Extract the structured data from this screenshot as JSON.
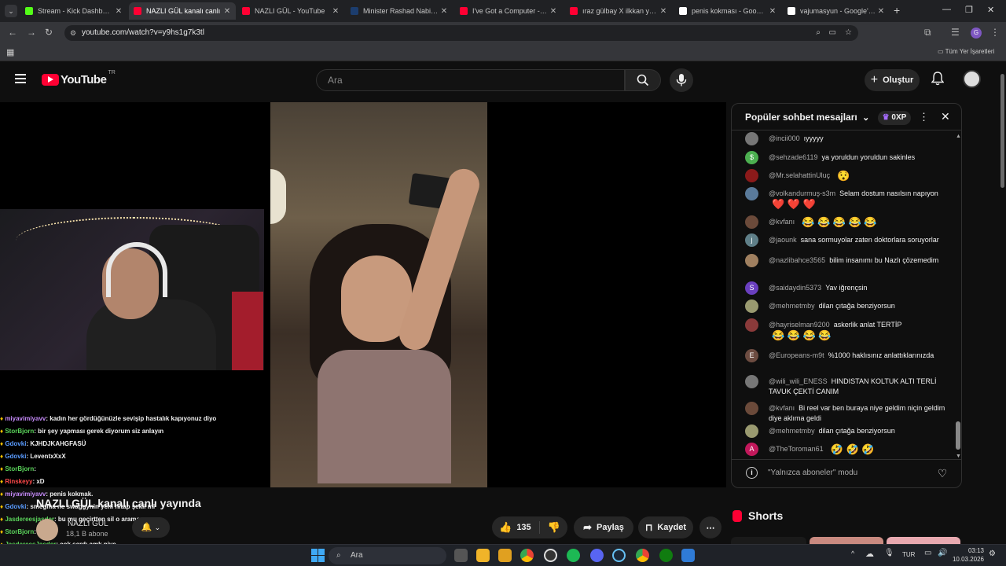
{
  "browser": {
    "tabs": [
      {
        "title": "Stream - Kick Dashboard",
        "color": "#53fc18"
      },
      {
        "title": "NAZLI GÜL kanalı canlı",
        "color": "#ff0033",
        "active": true
      },
      {
        "title": "NAZLI GÜL - YouTube",
        "color": "#ff0033"
      },
      {
        "title": "Minister Rashad Nabiyev",
        "color": "#1c3d6e"
      },
      {
        "title": "I've Got a Computer - You",
        "color": "#ff0033"
      },
      {
        "title": "ıraz gülbay X ilkkan yedin",
        "color": "#ff0033"
      },
      {
        "title": "penis kokması - Google'd",
        "color": "#ffffff"
      },
      {
        "title": "vajumasyun - Google'da",
        "color": "#ffffff"
      }
    ],
    "url": "youtube.com/watch?v=y9hs1g7k3tl",
    "bookmarks_label": "Tüm Yer İşaretleri"
  },
  "youtube": {
    "logo_text": "YouTube",
    "region": "TR",
    "search_placeholder": "Ara",
    "create_label": "Oluştur"
  },
  "stream_overlay_chat": [
    {
      "user": "miyavimiyavv",
      "color": "#c58af9",
      "text": ": kadın her gördüğünüzle sevişip hastalık kapıyonuz diyo"
    },
    {
      "user": "StorBjorn",
      "color": "#5bd45b",
      "text": ": bir şey yapması gerek diyorum siz anlayın"
    },
    {
      "user": "Gdovki",
      "color": "#5a9cff",
      "text": ": KJHDJKAHGFASÜ"
    },
    {
      "user": "Gdovki",
      "color": "#5a9cff",
      "text": ": LeventxXxX"
    },
    {
      "user": "StorBjorn",
      "color": "#5bd45b",
      "text": ":"
    },
    {
      "user": "Rinskeyy",
      "color": "#ff4a4a",
      "text": ": xD"
    },
    {
      "user": "miyavimiyavv",
      "color": "#c58af9",
      "text": ": penis kokmak."
    },
    {
      "user": "Gdovki",
      "color": "#5a9cff",
      "text": ": smegma ne swaggynin yeni hitap şekli mi"
    },
    {
      "user": "Jasdereesjasder",
      "color": "#5bd45b",
      "text": ": bu mu geçirtten sil o aramayı"
    },
    {
      "user": "StorBjorn",
      "color": "#5bd45b",
      "text": ":"
    },
    {
      "user": "JasdereesJasder",
      "color": "#5bd45b",
      "text": ": çok sardı amk niye"
    },
    {
      "user": "Gdovki",
      "color": "#5a9cff",
      "text": ": chute bak wili wili eness"
    }
  ],
  "video": {
    "title": "NAZLI GÜL kanalı canlı yayında",
    "channel": "NAZLI GÜL",
    "subscribers": "18,1 B abone",
    "likes": "135",
    "share_label": "Paylaş",
    "save_label": "Kaydet"
  },
  "live_chat": {
    "title": "Popüler sohbet mesajları",
    "xp": "0XP",
    "mode_text": "\"Yalnızca aboneler\" modu",
    "messages": [
      {
        "user": "@incii000",
        "text": "ıyyyyy",
        "avatar_color": "#777",
        "initial": ""
      },
      {
        "user": "@sehzade6119",
        "text": "ya yoruldun yoruldun sakinles",
        "avatar_color": "#4caf50",
        "initial": "$"
      },
      {
        "user": "@Mr.selahattinUluç",
        "text": "",
        "emoji": "😯",
        "avatar_color": "#8b1a1a",
        "initial": ""
      },
      {
        "user": "@volkandurmuş-s3m",
        "text": "Selam dostum nasılsın napıyon",
        "emoji": "❤️ ❤️ ❤️",
        "avatar_color": "#5a7a9a",
        "initial": ""
      },
      {
        "user": "@kvfanı",
        "text": "",
        "emoji": "😂 😂 😂 😂 😂",
        "avatar_color": "#6b4a3a",
        "initial": ""
      },
      {
        "user": "@jaounk",
        "text": "sana sormuyolar zaten doktorlara soruyorlar",
        "avatar_color": "#5f7f88",
        "initial": "j"
      },
      {
        "user": "@nazlibahce3565",
        "text": "bilim insanımı bu Nazlı çözemedim",
        "avatar_color": "#a08060",
        "initial": ""
      },
      {
        "user": "@saidaydin5373",
        "text": "Yav iğrençsin",
        "avatar_color": "#6a3fbf",
        "initial": "S"
      },
      {
        "user": "@mehmetmby",
        "text": "dilan çıtağa benziyorsun",
        "avatar_color": "#9a9a70",
        "initial": ""
      },
      {
        "user": "@hayriselman9200",
        "text": "askerlik anlat TERTİP",
        "emoji": "😂 😂 😂 😂",
        "avatar_color": "#8a3a3a",
        "initial": ""
      },
      {
        "user": "@Europeans-m9t",
        "text": "%1000 haklısınız anlattıklarınızda",
        "avatar_color": "#6d4c41",
        "initial": "E"
      },
      {
        "user": "@wili_wili_ENESS",
        "text": "HINDISTAN KOLTUK ALTI TERLİ TAVUK ÇEKTİ CANIM",
        "avatar_color": "#777",
        "initial": ""
      },
      {
        "user": "@kvfanı",
        "text": "Bi reel var ben buraya niye geldim niçin geldim diye aklıma geldi",
        "avatar_color": "#6b4a3a",
        "initial": ""
      },
      {
        "user": "@mehmetmby",
        "text": "dilan çıtağa benziyorsun",
        "avatar_color": "#9a9a70",
        "initial": ""
      },
      {
        "user": "@TheToroman61",
        "text": "",
        "emoji": "🤣 🤣 🤣",
        "avatar_color": "#c2185b",
        "initial": "A"
      }
    ]
  },
  "shorts_label": "Shorts",
  "taskbar": {
    "search_placeholder": "Ara",
    "language": "TUR",
    "time": "03:13",
    "date": "10.03.2026"
  }
}
